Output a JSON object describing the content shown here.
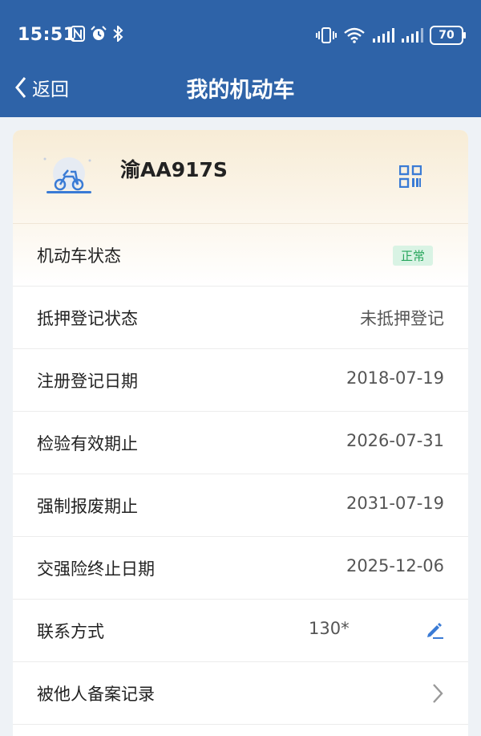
{
  "status_bar": {
    "time": "15:51",
    "battery": "70"
  },
  "nav": {
    "back_label": "返回",
    "title": "我的机动车"
  },
  "vehicle": {
    "plate": "渝AA917S"
  },
  "rows": [
    {
      "label": "机动车状态",
      "value": "正常"
    },
    {
      "label": "抵押登记状态",
      "value": "未抵押登记"
    },
    {
      "label": "注册登记日期",
      "value": "2018-07-19"
    },
    {
      "label": "检验有效期止",
      "value": "2026-07-31"
    },
    {
      "label": "强制报废期止",
      "value": "2031-07-19"
    },
    {
      "label": "交强险终止日期",
      "value": "2025-12-06"
    },
    {
      "label": "联系方式",
      "value": "130*"
    },
    {
      "label": "被他人备案记录",
      "value": ""
    }
  ],
  "colors": {
    "header_blue": "#2e63a8",
    "accent_blue": "#3a7bd5",
    "badge_green": "#28a65c"
  }
}
